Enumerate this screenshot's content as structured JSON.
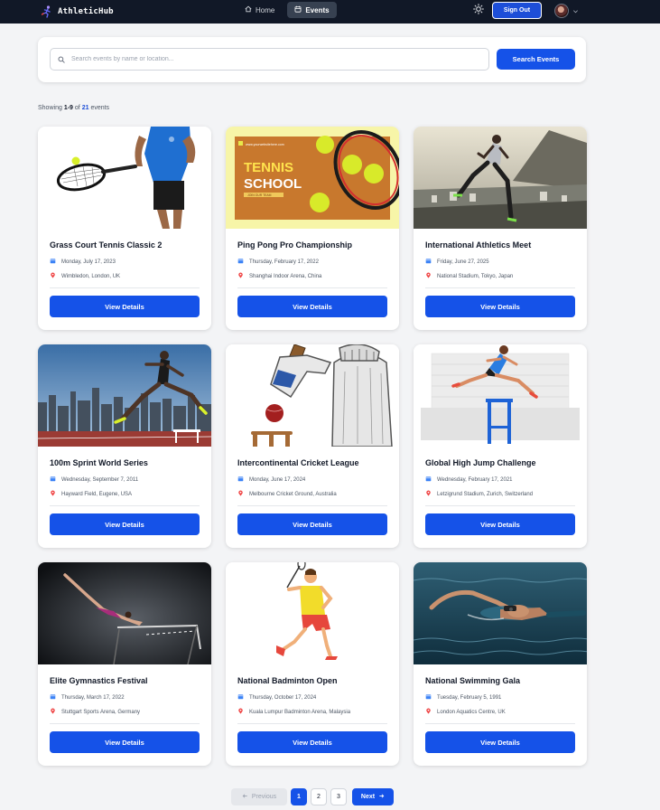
{
  "app": {
    "name": "AthleticHub"
  },
  "nav": {
    "links": [
      {
        "label": "Home",
        "icon": "home-icon"
      },
      {
        "label": "Events",
        "icon": "calendar-icon",
        "active": true
      }
    ],
    "theme_icon": "sun-icon",
    "sign_out_label": "Sign Out",
    "user_icon": "avatar"
  },
  "search": {
    "placeholder": "Search events by name or location...",
    "value": "",
    "button_label": "Search Events"
  },
  "results": {
    "prefix": "Showing",
    "range": "1-9",
    "of_word": "of",
    "total": "21",
    "suffix": "events"
  },
  "events": [
    {
      "title": "Grass Court Tennis Classic 2",
      "date": "Monday, July 17, 2023",
      "location": "Wimbledon, London, UK",
      "button": "View Details"
    },
    {
      "title": "Ping Pong Pro Championship",
      "date": "Thursday, February 17, 2022",
      "location": "Shanghai Indoor Arena, China",
      "button": "View Details",
      "image_text": {
        "banner_top": "www.yourwebsitehere.com",
        "big": "TENNIS",
        "big2": "SCHOOL",
        "small": "JOIN OUR TEAM"
      }
    },
    {
      "title": "International Athletics Meet",
      "date": "Friday, June 27, 2025",
      "location": "National Stadium, Tokyo, Japan",
      "button": "View Details"
    },
    {
      "title": "100m Sprint World Series",
      "date": "Wednesday, September 7, 2011",
      "location": "Hayward Field, Eugene, USA",
      "button": "View Details"
    },
    {
      "title": "Intercontinental Cricket League",
      "date": "Monday, June 17, 2024",
      "location": "Melbourne Cricket Ground, Australia",
      "button": "View Details"
    },
    {
      "title": "Global High Jump Challenge",
      "date": "Wednesday, February 17, 2021",
      "location": "Letzigrund Stadium, Zurich, Switzerland",
      "button": "View Details"
    },
    {
      "title": "Elite Gymnastics Festival",
      "date": "Thursday, March 17, 2022",
      "location": "Stuttgart Sports Arena, Germany",
      "button": "View Details"
    },
    {
      "title": "National Badminton Open",
      "date": "Thursday, October 17, 2024",
      "location": "Kuala Lumpur Badminton Arena, Malaysia",
      "button": "View Details"
    },
    {
      "title": "National Swimming Gala",
      "date": "Tuesday, February 5, 1991",
      "location": "London Aquatics Centre, UK",
      "button": "View Details"
    }
  ],
  "pagination": {
    "prev_label": "Previous",
    "pages": [
      "1",
      "2",
      "3"
    ],
    "current": "1",
    "next_label": "Next"
  },
  "colors": {
    "navbar": "#111827",
    "primary": "#1552e8",
    "background": "#f3f4f6",
    "location_pin": "#ef4444",
    "calendar": "#2563eb"
  }
}
